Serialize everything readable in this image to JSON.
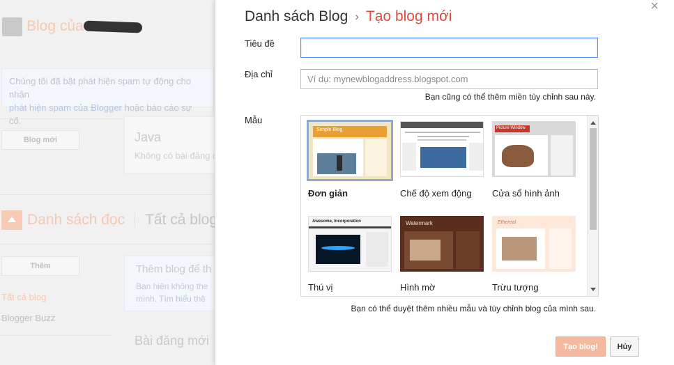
{
  "background": {
    "blog_title": "Blog của",
    "spam_notice": {
      "line1": "Chúng tôi đã bật phát hiện spam tự động cho nhận",
      "link": "phát hiện spam của Blogger",
      "line2_rest": " hoặc báo cáo sự cố."
    },
    "new_blog_button": "Blog mới",
    "blog_card": {
      "name": "Java",
      "subtitle": "Không có bài đăng c"
    },
    "reading_list": {
      "title": "Danh sách đọc",
      "tab_all": "Tất cả blog"
    },
    "add_button": "Thêm",
    "add_blog_card": {
      "title": "Thêm blog để th",
      "line1": "Bạn hiện không the",
      "line2": "mình.",
      "link": "Tìm hiểu thê"
    },
    "links": {
      "all_blogs": "Tất cả blog",
      "blogger_buzz": "Blogger Buzz"
    },
    "posts_heading": "Bài đăng mới"
  },
  "dialog": {
    "close_label": "×",
    "breadcrumb": {
      "root": "Danh sách Blog",
      "separator": "›",
      "current": "Tạo blog mới"
    },
    "title_field": {
      "label": "Tiêu đề",
      "value": "",
      "placeholder": ""
    },
    "address_field": {
      "label": "Địa chỉ",
      "value": "",
      "placeholder": "Ví dụ: mynewblogaddress.blogspot.com"
    },
    "address_hint": "Bạn cũng có thể thêm miền tùy chỉnh sau này.",
    "template_label": "Mẫu",
    "templates": [
      {
        "name": "Đơn giản",
        "selected": true,
        "thumb_title": "Simple Blog"
      },
      {
        "name": "Chế độ xem động",
        "selected": false,
        "thumb_title": ""
      },
      {
        "name": "Cửa sổ hình ảnh",
        "selected": false,
        "thumb_title": "Picture Window"
      },
      {
        "name": "Thú vị",
        "selected": false,
        "thumb_title": "Awesome, Incorporation"
      },
      {
        "name": "Hình mờ",
        "selected": false,
        "thumb_title": "Watermark"
      },
      {
        "name": "Trừu tượng",
        "selected": false,
        "thumb_title": "Ethereal"
      }
    ],
    "browse_hint": "Bạn có thể duyệt thêm nhiều mẫu và tùy chỉnh blog của mình sau.",
    "create_button": "Tạo blog!",
    "cancel_button": "Hủy"
  },
  "colors": {
    "accent": "#dd4b39",
    "create_button": "#f4b99e",
    "focus_border": "#4d90fe",
    "selected_template_border": "#8fa9cf"
  }
}
